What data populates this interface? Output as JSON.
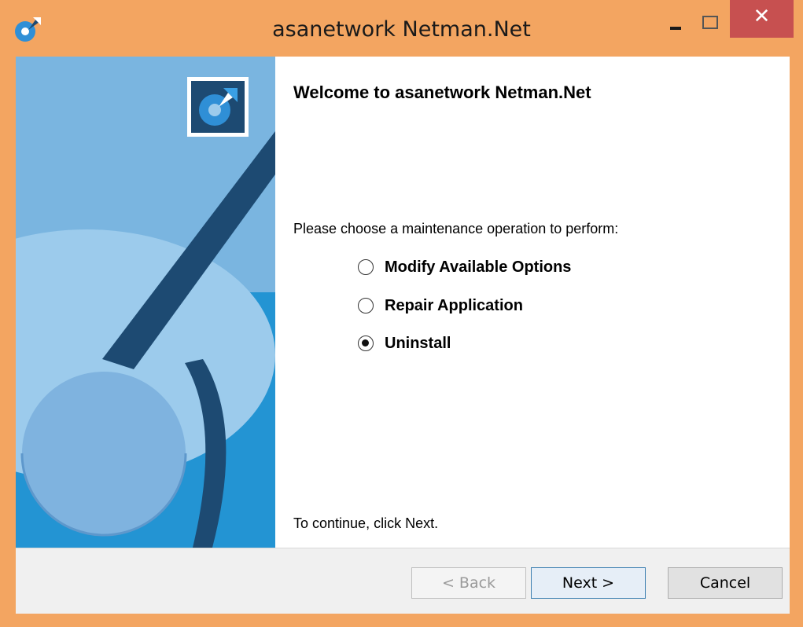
{
  "window": {
    "title": "asanetwork Netman.Net"
  },
  "titlebar": {
    "minimize_icon": "minimize-icon",
    "maximize_icon": "maximize-icon",
    "close_icon": "close-icon",
    "close_glyph": "✕"
  },
  "main": {
    "welcome": "Welcome to asanetwork Netman.Net",
    "prompt": "Please choose a maintenance operation to perform:",
    "options": [
      {
        "label": "Modify Available Options",
        "checked": false
      },
      {
        "label": "Repair Application",
        "checked": false
      },
      {
        "label": "Uninstall",
        "checked": true
      }
    ],
    "continue_text": "To continue, click Next."
  },
  "buttons": {
    "back": "< Back",
    "next": "Next >",
    "cancel": "Cancel"
  },
  "colors": {
    "frame": "#f3a561",
    "close_button": "#c75050",
    "banner_blue": "#2394d3",
    "banner_dark": "#1d4a72",
    "banner_light": "#8cc3e8"
  }
}
